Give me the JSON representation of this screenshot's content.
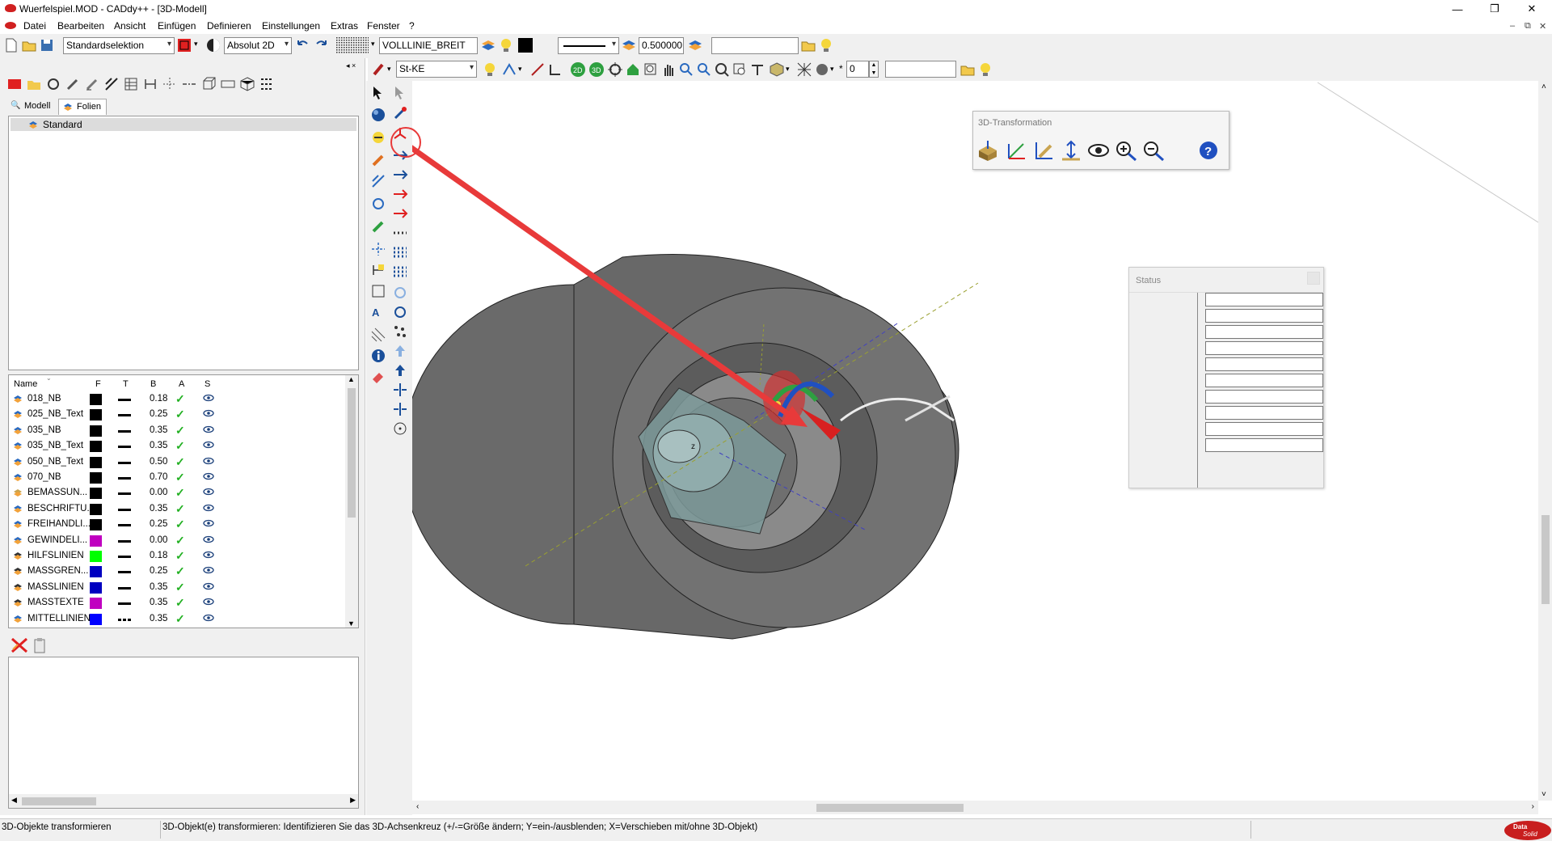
{
  "window": {
    "title": "Wuerfelspiel.MOD  -  CADdy++ - [3D-Modell]",
    "minimize": "—",
    "restore": "❐",
    "close": "✕"
  },
  "menu": [
    "Datei",
    "Bearbeiten",
    "Ansicht",
    "Einfügen",
    "Definieren",
    "Einstellungen",
    "Extras",
    "Fenster",
    "?"
  ],
  "mdi_controls": {
    "minimize": "–",
    "restore": "⧉",
    "close": "✕"
  },
  "toolbar1": {
    "selection_mode": "Standardselektion",
    "coordinate_mode": "Absolut 2D",
    "line_type_name": "VOLLLINIE_BREIT",
    "line_width": "0.500000",
    "text_field": ""
  },
  "toolbar2": {
    "layer_combo": "St-KE",
    "spin_value": "0",
    "star": "*",
    "text_field": ""
  },
  "left_panel": {
    "tabs": [
      "Modell",
      "Folien"
    ],
    "active_tab": "Folien",
    "tree_selected": "Standard",
    "list_headers": {
      "name": "Name",
      "f": "F",
      "t": "T",
      "b": "B",
      "a": "A",
      "s": "S"
    },
    "layers": [
      {
        "name": "018_NB",
        "color": "#000000",
        "width": "0.18",
        "line": "solid"
      },
      {
        "name": "025_NB_Text",
        "color": "#000000",
        "width": "0.25",
        "line": "solid"
      },
      {
        "name": "035_NB",
        "color": "#000000",
        "width": "0.35",
        "line": "solid"
      },
      {
        "name": "035_NB_Text",
        "color": "#000000",
        "width": "0.35",
        "line": "solid"
      },
      {
        "name": "050_NB_Text",
        "color": "#000000",
        "width": "0.50",
        "line": "solid"
      },
      {
        "name": "070_NB",
        "color": "#000000",
        "width": "0.70",
        "line": "solid"
      },
      {
        "name": "BEMASSUN...",
        "color": "#000000",
        "width": "0.00",
        "line": "solid"
      },
      {
        "name": "BESCHRIFTU...",
        "color": "#000000",
        "width": "0.35",
        "line": "solid"
      },
      {
        "name": "FREIHANDLI...",
        "color": "#000000",
        "width": "0.25",
        "line": "solid"
      },
      {
        "name": "GEWINDELI...",
        "color": "#c000c0",
        "width": "0.00",
        "line": "solid"
      },
      {
        "name": "HILFSLINIEN",
        "color": "#00ff00",
        "width": "0.18",
        "line": "solid"
      },
      {
        "name": "MASSGREN...",
        "color": "#0000c0",
        "width": "0.25",
        "line": "solid"
      },
      {
        "name": "MASSLINIEN",
        "color": "#0000c0",
        "width": "0.35",
        "line": "solid"
      },
      {
        "name": "MASSTEXTE",
        "color": "#c000c0",
        "width": "0.35",
        "line": "solid"
      },
      {
        "name": "MITTELLINIEN",
        "color": "#0000ff",
        "width": "0.35",
        "line": "dash"
      }
    ],
    "check_glyph": "✓"
  },
  "panel_3d": {
    "title": "3D-Transformation"
  },
  "status_panel": {
    "title": "Status"
  },
  "canvas_labels": {
    "axis_z": "z"
  },
  "statusbar": {
    "left": "3D-Objekte transformieren",
    "message": "3D-Objekt(e) transformieren: Identifizieren Sie das 3D-Achsenkreuz (+/-=Größe ändern; Y=ein-/ausblenden; X=Verschieben mit/ohne 3D-Objekt)"
  },
  "colors": {
    "accent_red": "#e83a3a",
    "model_gray": "#6b6b6b",
    "toolbar_bg": "#f0f0f0"
  },
  "logo": "Data Solid"
}
